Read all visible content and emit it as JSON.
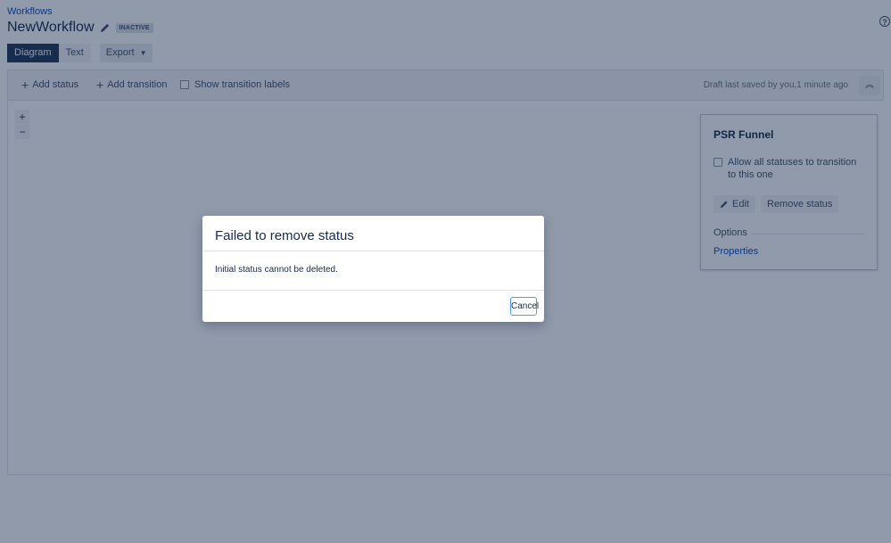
{
  "header": {
    "breadcrumb": "Workflows",
    "title": "NewWorkflow",
    "status_badge": "INACTIVE",
    "help_icon": "help-icon"
  },
  "tabs": [
    {
      "label": "Diagram",
      "active": true
    },
    {
      "label": "Text",
      "active": false
    }
  ],
  "export": {
    "label": "Export"
  },
  "toolbar": {
    "add_status": "Add status",
    "add_transition": "Add transition",
    "show_transition_labels": "Show transition labels",
    "draft_text": "Draft last saved by you,1 minute ago"
  },
  "zoom": {
    "in": "+",
    "out": "−"
  },
  "side_panel": {
    "title": "PSR Funnel",
    "allow_all_label": "Allow all statuses to transition to this one",
    "edit_label": "Edit",
    "remove_label": "Remove status",
    "options_label": "Options",
    "properties_link": "Properties"
  },
  "dialog": {
    "title": "Failed to remove status",
    "body": "Initial status cannot be deleted.",
    "cancel_label": "Cancel"
  },
  "colors": {
    "accent": "#0052cc",
    "active_tab": "#253858",
    "overlay": "#091e42",
    "focus_ring": "#4c9aff"
  }
}
